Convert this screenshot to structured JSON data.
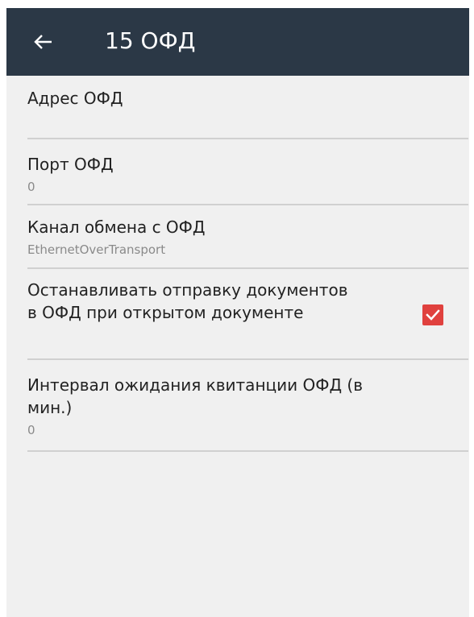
{
  "header": {
    "title": "15 ОФД"
  },
  "preferences": [
    {
      "title": "Адрес ОФД",
      "summary": ""
    },
    {
      "title": "Порт ОФД",
      "summary": "0"
    },
    {
      "title": "Канал обмена с ОФД",
      "summary": "EthernetOverTransport"
    },
    {
      "title_line1": "Останавливать отправку документов",
      "title_line2": "в ОФД при открытом документе",
      "checked": true
    },
    {
      "title_line1": "Интервал ожидания квитанции ОФД (в",
      "title_line2": "мин.)",
      "summary": "0"
    }
  ],
  "colors": {
    "appbar": "#2b3846",
    "background": "#f0f0f0",
    "checkbox": "#e0413e",
    "divider": "#d0d0d0"
  },
  "icons": {
    "back": "arrow-left-icon",
    "check": "checkmark-icon"
  }
}
